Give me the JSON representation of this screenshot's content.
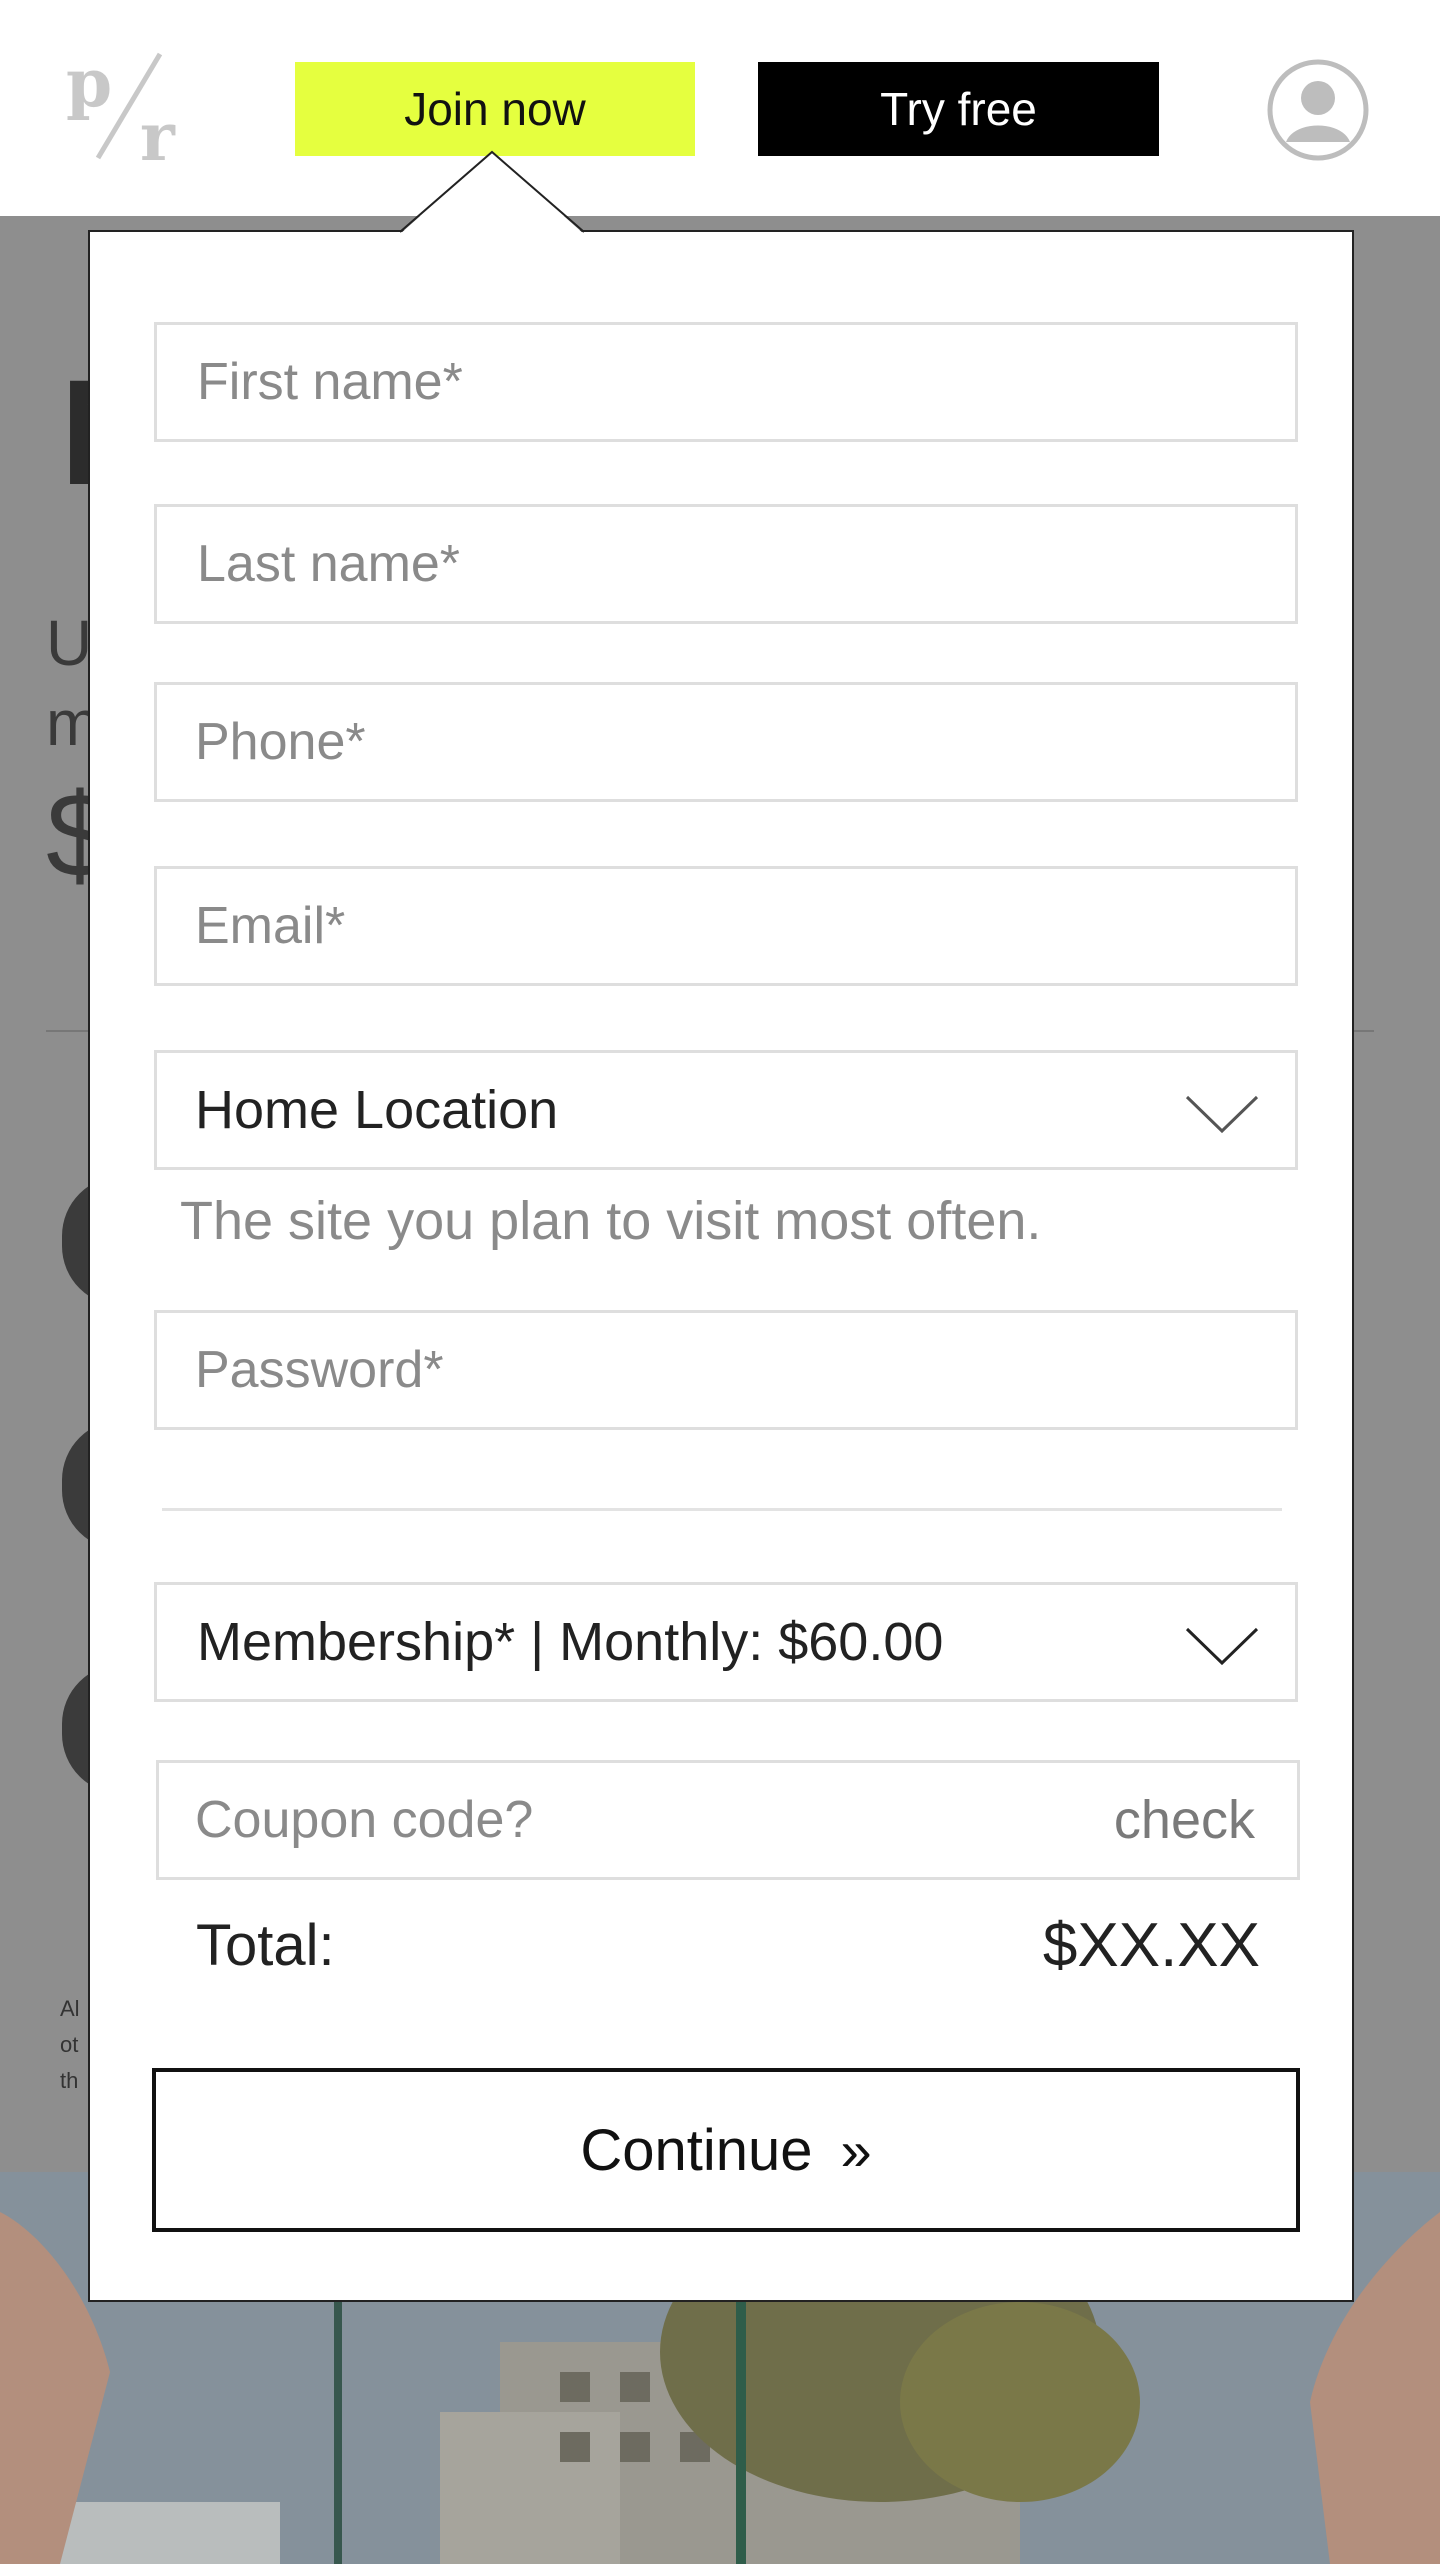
{
  "header": {
    "logo_text": "p/r",
    "join_label": "Join now",
    "try_label": "Try free",
    "colors": {
      "join_bg": "#e5ff3f",
      "try_bg": "#000000"
    }
  },
  "form": {
    "first_name_placeholder": "First name*",
    "last_name_placeholder": "Last name*",
    "phone_placeholder": "Phone*",
    "email_placeholder": "Email*",
    "home_location_label": "Home Location",
    "home_location_helper": "The site you plan to visit most often.",
    "password_placeholder": "Password*",
    "membership_label": "Membership* | Monthly: $60.00",
    "coupon_placeholder": "Coupon code?",
    "coupon_check_label": "check",
    "total_label": "Total:",
    "total_value": "$XX.XX",
    "continue_label": "Continue",
    "continue_arrow": "»"
  }
}
